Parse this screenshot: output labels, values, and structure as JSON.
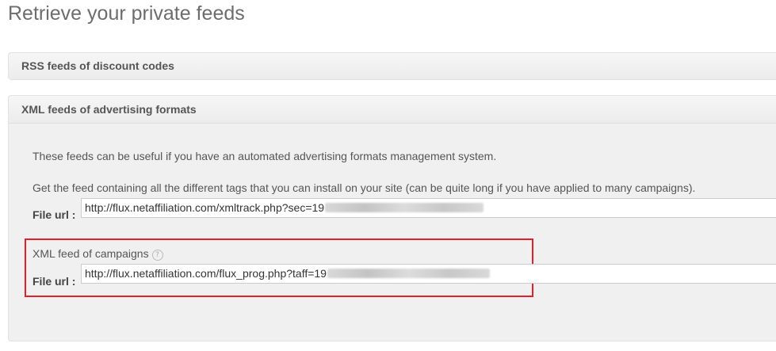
{
  "page": {
    "title": "Retrieve your private feeds"
  },
  "panels": {
    "rss": {
      "header": "RSS feeds of discount codes"
    },
    "xml": {
      "header": "XML feeds of advertising formats",
      "intro": "These feeds can be useful if you have an automated advertising formats management system.",
      "tags_feed": {
        "description": "Get the feed containing all the different tags that you can install on your site (can be quite long if you have applied to many campaigns).",
        "label": "File url :",
        "url": "http://flux.netaffiliation.com/xmltrack.php?sec=19"
      },
      "campaigns_feed": {
        "title": "XML feed of campaigns",
        "help_icon": "question-circle-icon",
        "label": "File url :",
        "url": "http://flux.netaffiliation.com/flux_prog.php?taff=19"
      }
    }
  },
  "colors": {
    "highlight": "#e0202a",
    "panel_bg": "#f0f0f0"
  }
}
